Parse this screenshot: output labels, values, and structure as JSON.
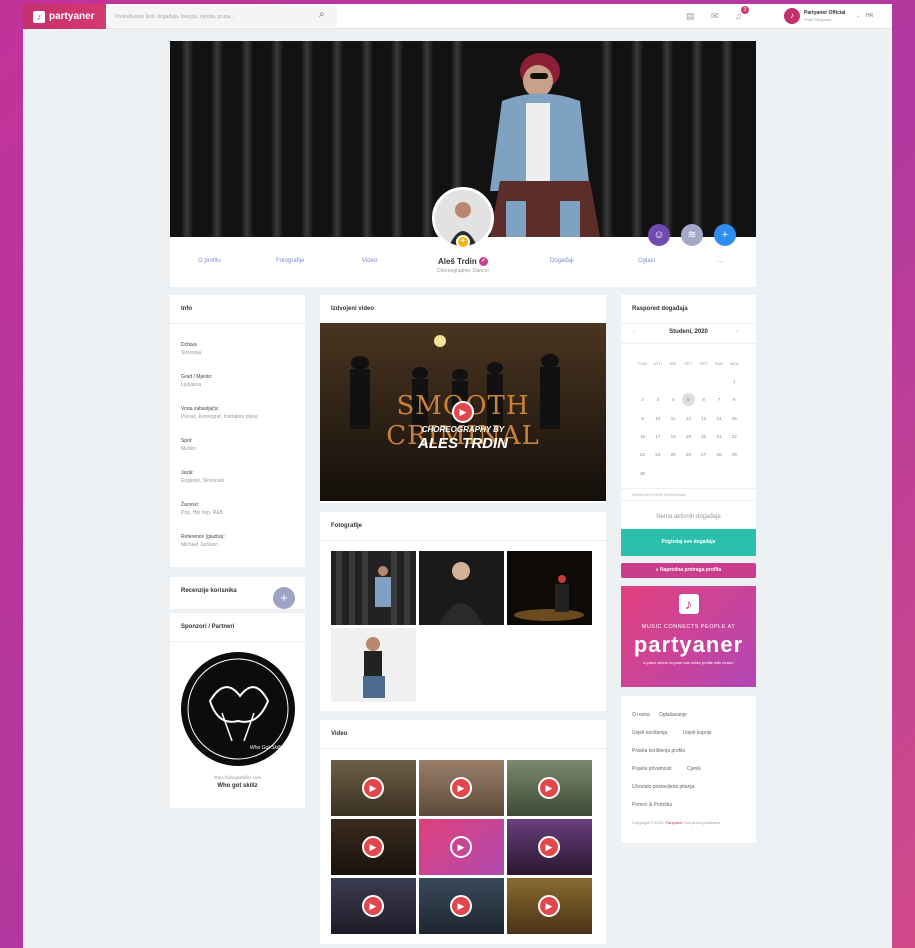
{
  "brand": {
    "name": "partyaner",
    "accent": "#c42f6f",
    "link_color": "#7f8acf",
    "play_color": "#e2474b",
    "teal": "#2bbfae"
  },
  "topbar": {
    "search_placeholder": "Pretraživanje ljudi, događaja, lokacija, mjesta, grupa...",
    "notifications_count": "3",
    "user_name": "Partyaner Official",
    "user_sub": "Profil Partyaner",
    "lang": "HR"
  },
  "profile": {
    "name": "Aleš Trdin",
    "title": "Choreographer, Dancer",
    "tabs": [
      "O profilu",
      "Fotografije",
      "Video",
      "Događaji",
      "Oglasi",
      "..."
    ]
  },
  "info": {
    "title": "Info",
    "fields": [
      {
        "label": "Država",
        "value": "Slovenija"
      },
      {
        "label": "Grad / Mjesto:",
        "value": "Ljubljana"
      },
      {
        "label": "Vrsta zabavljača:",
        "value": "Plesač, Koreograf, Instruktor plesa"
      },
      {
        "label": "Spol:",
        "value": "Muško"
      },
      {
        "label": "Jezik:",
        "value": "Engleski, Slovenski"
      },
      {
        "label": "Žanrovi:",
        "value": "Pop, Hip hop, R&B"
      },
      {
        "label": "Reference (glazba):",
        "value": "Michael Jackson"
      }
    ]
  },
  "reviews": {
    "title": "Recenzije korisnika"
  },
  "sponsors": {
    "title": "Sponzori / Partneri",
    "url": "https://whogotskillz.com",
    "name": "Who got skillz",
    "logo_text": "Who Got Skillz?"
  },
  "featured": {
    "title": "Izdvojeni video",
    "overlay_title": "SMOOTH CRIMINAL",
    "overlay_sub": "CHOREOGRAPHY BY",
    "overlay_name": "ALES TRDIN"
  },
  "photos": {
    "title": "Fotografije"
  },
  "videos": {
    "title": "Video",
    "labels": [
      "",
      "",
      "",
      "",
      "",
      "",
      "",
      "",
      ""
    ]
  },
  "events": {
    "title": "Raspored događaja",
    "month": "Studeni, 2020",
    "dow": [
      "PON",
      "UTO",
      "SRI",
      "ČET",
      "PET",
      "SUB",
      "NED"
    ],
    "days": [
      "1",
      "2",
      "3",
      "4",
      "5",
      "6",
      "7",
      "8",
      "9",
      "10",
      "11",
      "12",
      "13",
      "14",
      "15",
      "16",
      "17",
      "18",
      "19",
      "20",
      "21",
      "22",
      "23",
      "24",
      "25",
      "26",
      "27",
      "28",
      "29",
      "30"
    ],
    "today": "5",
    "legend": "NEMA AKTIVNIH DOGAĐAJA",
    "empty": "Nema aktivnih događaja",
    "view_button": "Pogledaj sve događaje",
    "search_button": "Napredna pretraga profila"
  },
  "promo": {
    "tagline": "MUSIC CONNECTS PEOPLE AT",
    "brand": "partyaner",
    "small": "a place where anyone can make profile with music!"
  },
  "footer": {
    "links": [
      "O nama",
      "Oglašavanje",
      "Uvjeti korištenja",
      "Uvjeti kupnje",
      "Pravila korištenja profila",
      "Pravila privatnosti",
      "Cjenik",
      "Učestalo postavljena pitanja",
      "Pomoć & Podrška"
    ],
    "copyright": "Copyright © 2020.",
    "copyright_brand": "Partyaner",
    "copyright_rest": "Sva prava pridržana"
  }
}
